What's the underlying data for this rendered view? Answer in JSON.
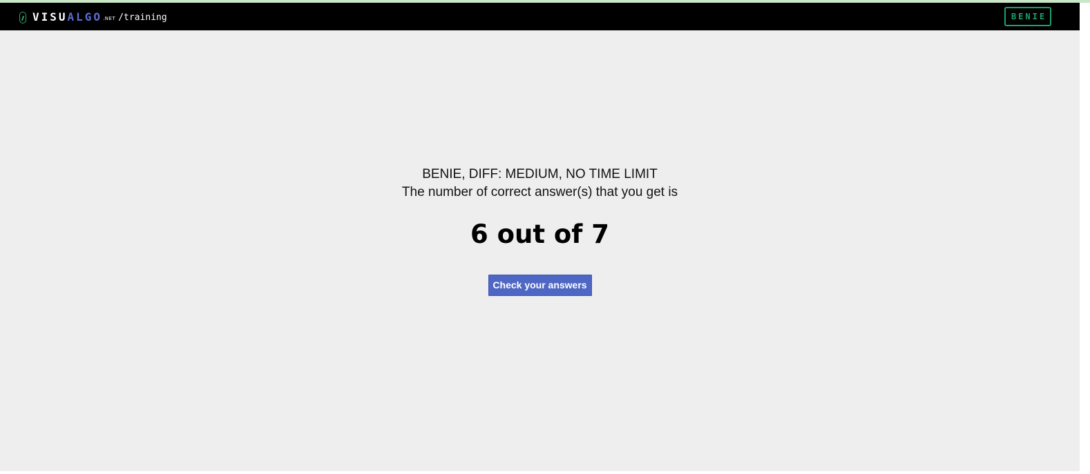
{
  "header": {
    "logo_visu": "VISU",
    "logo_algo": "ALGO",
    "logo_net": ".NET",
    "path": "/training",
    "user_label": "BENIE"
  },
  "result": {
    "heading": "BENIE, DIFF: MEDIUM, NO TIME LIMIT",
    "subtext": "The number of correct answer(s) that you get is",
    "score_text": "6 out of 7",
    "button_label": "Check your answers"
  },
  "colors": {
    "navbar_bg": "#000000",
    "page_bg": "#eeeeee",
    "algo_accent": "#5a6fd4",
    "user_badge": "#1aa36a",
    "button_bg": "#4f67c4"
  }
}
